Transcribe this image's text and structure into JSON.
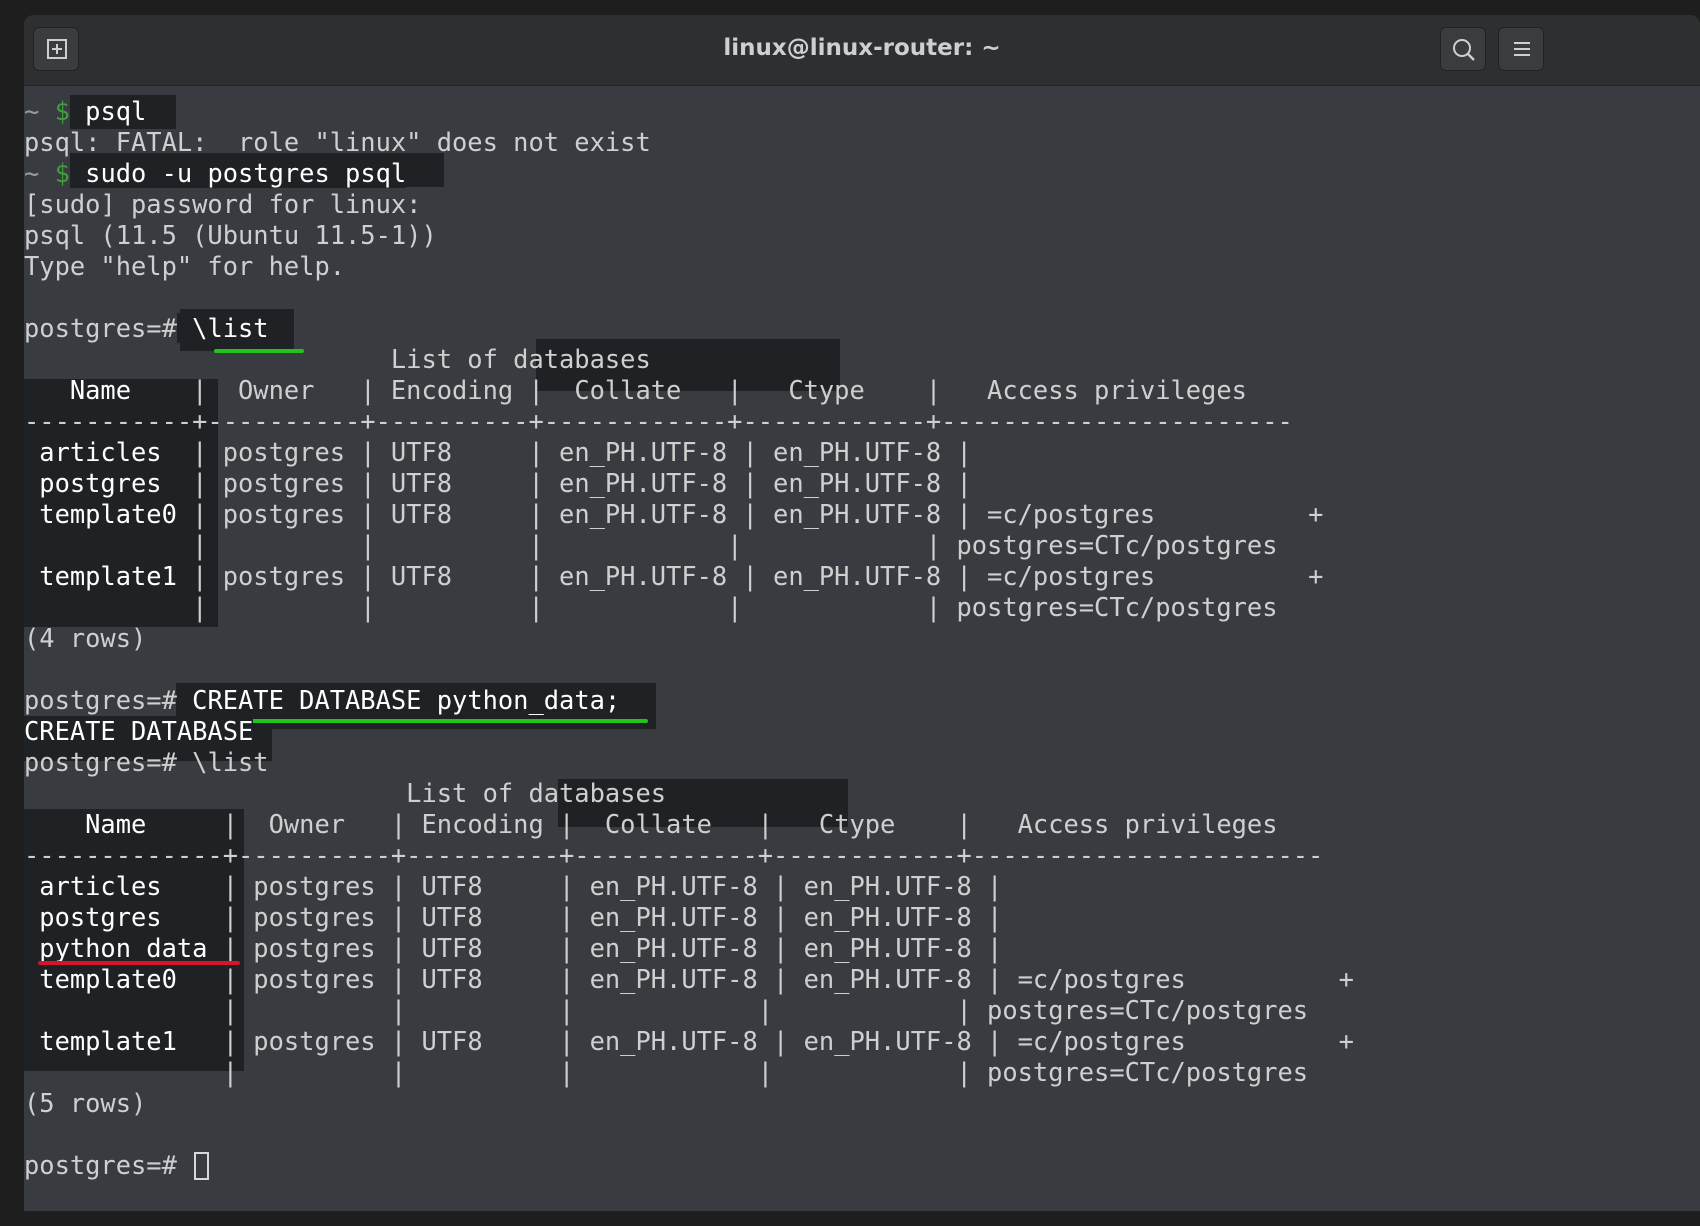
{
  "window": {
    "title": "linux@linux-router: ~"
  },
  "icons": {
    "new_tab": "new-tab-icon",
    "search": "search-icon",
    "menu": "hamburger-menu-icon"
  },
  "terminal": {
    "prompt_shell": {
      "tilde": "~",
      "dollar": "$"
    },
    "psql_prompt": "postgres=#",
    "cmd1": " psql",
    "err1": "psql: FATAL:  role \"linux\" does not exist",
    "cmd2": " sudo -u postgres psql",
    "sudo_msg": "[sudo] password for linux:",
    "version_msg": "psql (11.5 (Ubuntu 11.5-1))",
    "help_msg": "Type \"help\" for help.",
    "list_cmd": " \\list",
    "create_cmd": " CREATE DATABASE python_data;",
    "create_resp": "CREATE DATABASE",
    "list_cmd2": " \\list",
    "table1": {
      "caption": "                        List of databases",
      "header_name": "   Name    ",
      "header_rest": "|  Owner   | Encoding |  Collate   |   Ctype    |   Access privileges   ",
      "divider": "-----------+----------+----------+------------+------------+-----------------------",
      "name_cells": [
        " articles  ",
        " postgres  ",
        " template0 ",
        "           ",
        " template1 ",
        "           "
      ],
      "rest_cells": [
        "| postgres | UTF8     | en_PH.UTF-8 | en_PH.UTF-8 | ",
        "| postgres | UTF8     | en_PH.UTF-8 | en_PH.UTF-8 | ",
        "| postgres | UTF8     | en_PH.UTF-8 | en_PH.UTF-8 | =c/postgres          +",
        "|          |          |            |            | postgres=CTc/postgres",
        "| postgres | UTF8     | en_PH.UTF-8 | en_PH.UTF-8 | =c/postgres          +",
        "|          |          |            |            | postgres=CTc/postgres"
      ],
      "rows_footer": "(4 rows)"
    },
    "table2": {
      "caption": "                         List of databases",
      "header_name": "    Name     ",
      "header_rest": "|  Owner   | Encoding |  Collate   |   Ctype    |   Access privileges   ",
      "divider": "-------------+----------+----------+------------+------------+-----------------------",
      "name_cells": [
        " articles    ",
        " postgres    ",
        " python_data ",
        " template0   ",
        "             ",
        " template1   ",
        "             "
      ],
      "rest_cells": [
        "| postgres | UTF8     | en_PH.UTF-8 | en_PH.UTF-8 | ",
        "| postgres | UTF8     | en_PH.UTF-8 | en_PH.UTF-8 | ",
        "| postgres | UTF8     | en_PH.UTF-8 | en_PH.UTF-8 | ",
        "| postgres | UTF8     | en_PH.UTF-8 | en_PH.UTF-8 | =c/postgres          +",
        "|          |          |            |            | postgres=CTc/postgres",
        "| postgres | UTF8     | en_PH.UTF-8 | en_PH.UTF-8 | =c/postgres          +",
        "|          |          |            |            | postgres=CTc/postgres"
      ],
      "rows_footer": "(5 rows)"
    }
  },
  "colors": {
    "window_bg": "#383c40",
    "titlebar_bg": "#2d2f31",
    "highlight_box": "#1e2224",
    "annotation_green": "#22c31d",
    "annotation_red": "#d6142a"
  }
}
